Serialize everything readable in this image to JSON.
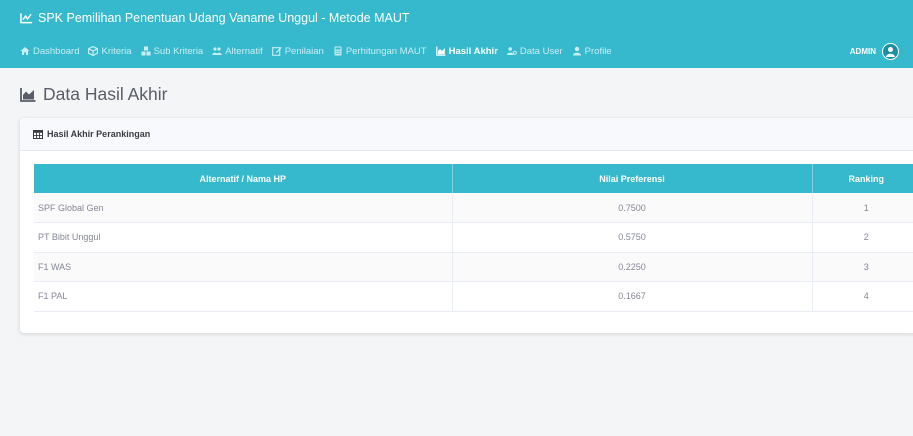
{
  "app": {
    "title": "SPK Pemilihan Penentuan Udang Vaname Unggul - Metode MAUT",
    "accent_color": "#36b9cc"
  },
  "nav": {
    "items": [
      {
        "label": "Dashboard",
        "icon": "home-icon"
      },
      {
        "label": "Kriteria",
        "icon": "cube-icon"
      },
      {
        "label": "Sub Kriteria",
        "icon": "cubes-icon"
      },
      {
        "label": "Alternatif",
        "icon": "users-icon"
      },
      {
        "label": "Penilaian",
        "icon": "edit-icon"
      },
      {
        "label": "Perhitungan MAUT",
        "icon": "calculator-icon"
      },
      {
        "label": "Hasil Akhir",
        "icon": "chart-area-icon",
        "active": true
      },
      {
        "label": "Data User",
        "icon": "users-cog-icon"
      },
      {
        "label": "Profile",
        "icon": "user-icon"
      }
    ]
  },
  "user": {
    "name": "ADMIN"
  },
  "page": {
    "title": "Data Hasil Akhir"
  },
  "card": {
    "title": "Hasil Akhir Perankingan"
  },
  "table": {
    "headers": [
      "Alternatif / Nama HP",
      "Nilai Preferensi",
      "Ranking"
    ],
    "rows": [
      [
        "SPF Global Gen",
        "0.7500",
        "1"
      ],
      [
        "PT Bibit Unggul",
        "0.5750",
        "2"
      ],
      [
        "F1 WAS",
        "0.2250",
        "3"
      ],
      [
        "F1 PAL",
        "0.1667",
        "4"
      ]
    ]
  }
}
